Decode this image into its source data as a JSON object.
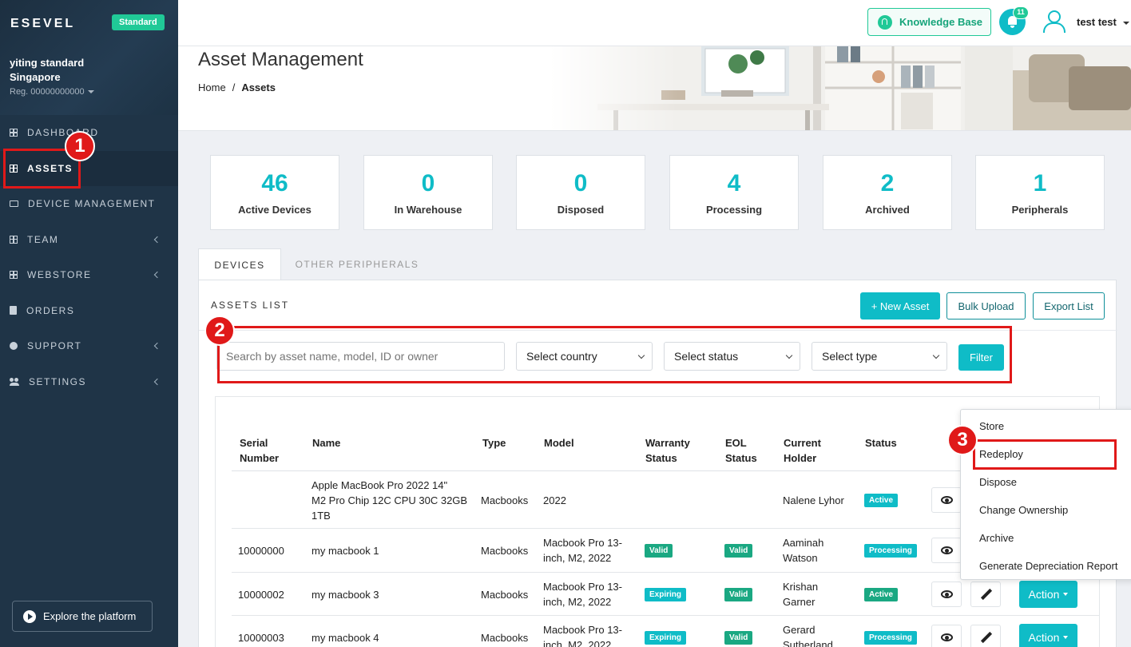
{
  "sidebar": {
    "logo": "ESEVEL",
    "plan_badge": "Standard",
    "org_name_line1": "yiting standard",
    "org_name_line2": "Singapore",
    "org_reg": "Reg. 00000000000",
    "nav": [
      {
        "label": "DASHBOARD",
        "icon": "grid-icon"
      },
      {
        "label": "ASSETS",
        "icon": "grid-icon",
        "active": true
      },
      {
        "label": "DEVICE MANAGEMENT",
        "icon": "laptop-icon"
      },
      {
        "label": "TEAM",
        "icon": "grid-icon",
        "expandable": true
      },
      {
        "label": "WEBSTORE",
        "icon": "grid-icon",
        "expandable": true
      },
      {
        "label": "ORDERS",
        "icon": "document-icon"
      },
      {
        "label": "SUPPORT",
        "icon": "info-icon",
        "expandable": true
      },
      {
        "label": "SETTINGS",
        "icon": "people-icon",
        "expandable": true
      }
    ],
    "explore_label": "Explore the platform"
  },
  "topbar": {
    "knowledge_base_label": "Knowledge Base",
    "notification_count": "11",
    "user_name": "test test"
  },
  "header": {
    "title": "Asset Management",
    "breadcrumb_home": "Home",
    "breadcrumb_sep": "/",
    "breadcrumb_current": "Assets"
  },
  "stats": [
    {
      "value": "46",
      "label": "Active Devices"
    },
    {
      "value": "0",
      "label": "In Warehouse"
    },
    {
      "value": "0",
      "label": "Disposed"
    },
    {
      "value": "4",
      "label": "Processing"
    },
    {
      "value": "2",
      "label": "Archived"
    },
    {
      "value": "1",
      "label": "Peripherals"
    }
  ],
  "tabs": {
    "devices": "DEVICES",
    "peripherals": "OTHER PERIPHERALS"
  },
  "assets_list": {
    "title": "ASSETS LIST",
    "new_asset_label": "+ New Asset",
    "bulk_upload_label": "Bulk Upload",
    "export_label": "Export List"
  },
  "filters": {
    "search_placeholder": "Search by asset name, model, ID or owner",
    "country": "Select country",
    "status": "Select status",
    "type": "Select type",
    "filter_label": "Filter"
  },
  "table": {
    "headers": {
      "serial_1": "Serial",
      "serial_2": "Number",
      "name": "Name",
      "type": "Type",
      "model": "Model",
      "warranty_1": "Warranty",
      "warranty_2": "Status",
      "eol_1": "EOL",
      "eol_2": "Status",
      "holder_1": "Current",
      "holder_2": "Holder",
      "status": "Status"
    },
    "rows": [
      {
        "serial": "",
        "name_1": "Apple MacBook Pro 2022 14\"",
        "name_2": "M2 Pro Chip 12C CPU 30C 32GB",
        "name_3": "1TB",
        "type": "Macbooks",
        "model_1": "2022",
        "model_2": "",
        "warranty": "",
        "eol": "",
        "holder_1": "Nalene Lyhor",
        "holder_2": "",
        "status": "Active"
      },
      {
        "serial": "10000000",
        "name_1": "my macbook 1",
        "type": "Macbooks",
        "model_1": "Macbook Pro 13-",
        "model_2": "inch, M2, 2022",
        "warranty": "Valid",
        "eol": "Valid",
        "holder_1": "Aaminah",
        "holder_2": "Watson",
        "status": "Processing"
      },
      {
        "serial": "10000002",
        "name_1": "my macbook 3",
        "type": "Macbooks",
        "model_1": "Macbook Pro 13-",
        "model_2": "inch, M2, 2022",
        "warranty": "Expiring",
        "eol": "Valid",
        "holder_1": "Krishan",
        "holder_2": "Garner",
        "status": "Active"
      },
      {
        "serial": "10000003",
        "name_1": "my macbook 4",
        "type": "Macbooks",
        "model_1": "Macbook Pro 13-",
        "model_2": "inch, M2, 2022",
        "warranty": "Expiring",
        "eol": "Valid",
        "holder_1": "Gerard",
        "holder_2": "Sutherland",
        "status": "Processing"
      }
    ],
    "action_label": "Action"
  },
  "action_menu": [
    "Store",
    "Redeploy",
    "Dispose",
    "Change Ownership",
    "Archive",
    "Generate Depreciation Report"
  ],
  "annotations": [
    "1",
    "2",
    "3"
  ],
  "colors": {
    "accent": "#0fbcc7",
    "green": "#20c997",
    "sidebar": "#1f3447",
    "annotation": "#e01919"
  }
}
